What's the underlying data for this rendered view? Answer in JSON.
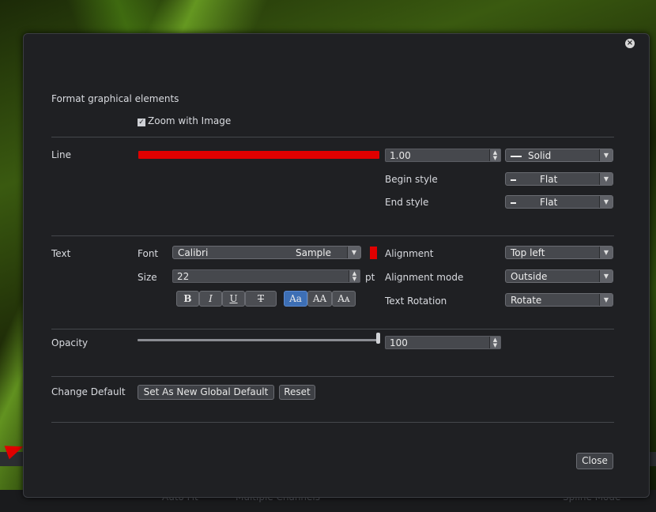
{
  "dialog": {
    "heading": "Format graphical elements",
    "zoom_with_image": {
      "label": "Zoom with Image",
      "checked": true
    },
    "line": {
      "label": "Line",
      "color": "#e00000",
      "width_value": "1.00",
      "style_value": "Solid",
      "begin_style_label": "Begin style",
      "begin_style_value": "Flat",
      "end_style_label": "End style",
      "end_style_value": "Flat"
    },
    "text": {
      "label": "Text",
      "font_label": "Font",
      "font_value": "Calibri",
      "font_sample": "Sample",
      "color": "#e00000",
      "size_label": "Size",
      "size_value": "22",
      "size_unit": "pt",
      "bold": "B",
      "italic": "I",
      "underline": "U",
      "strikethrough": "T",
      "case_normal": "Aa",
      "case_upper": "AA",
      "case_small": "Aᴀ",
      "alignment_label": "Alignment",
      "alignment_value": "Top left",
      "alignment_mode_label": "Alignment mode",
      "alignment_mode_value": "Outside",
      "text_rotation_label": "Text Rotation",
      "text_rotation_value": "Rotate"
    },
    "opacity": {
      "label": "Opacity",
      "value": "100",
      "fraction": 1.0
    },
    "change_default": {
      "label": "Change Default",
      "set_global_button": "Set As New Global Default",
      "reset_button": "Reset"
    },
    "close_button": "Close",
    "close_icon": "close-icon"
  },
  "background": {
    "auto_fit_label": "Auto Fit",
    "multiple_channels_label": "Multiple Channels",
    "spline_mode_label": "Spline Mode"
  }
}
